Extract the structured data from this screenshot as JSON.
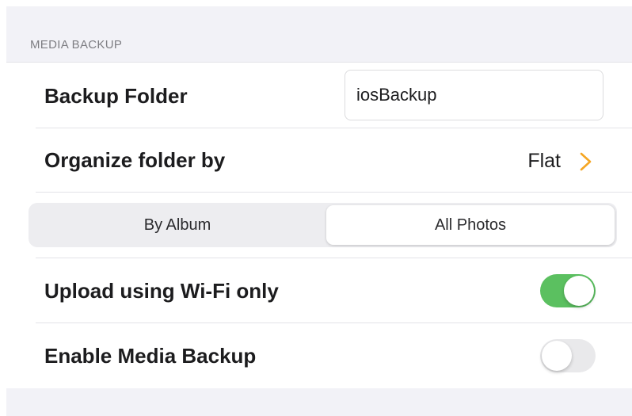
{
  "section": {
    "header": "MEDIA BACKUP"
  },
  "backup_folder": {
    "label": "Backup Folder",
    "value": "iosBackup"
  },
  "organize": {
    "label": "Organize folder by",
    "value": "Flat",
    "chevron_icon": "chevron-right-icon"
  },
  "segmented": {
    "options": [
      "By Album",
      "All Photos"
    ],
    "selected": "All Photos"
  },
  "wifi_only": {
    "label": "Upload using Wi-Fi only",
    "on": true
  },
  "media_backup": {
    "label": "Enable Media Backup",
    "on": false
  },
  "colors": {
    "accent_chevron": "#f5a623",
    "toggle_on": "#5bc060",
    "toggle_off": "#e9e9eb",
    "group_background": "#f2f2f7"
  }
}
